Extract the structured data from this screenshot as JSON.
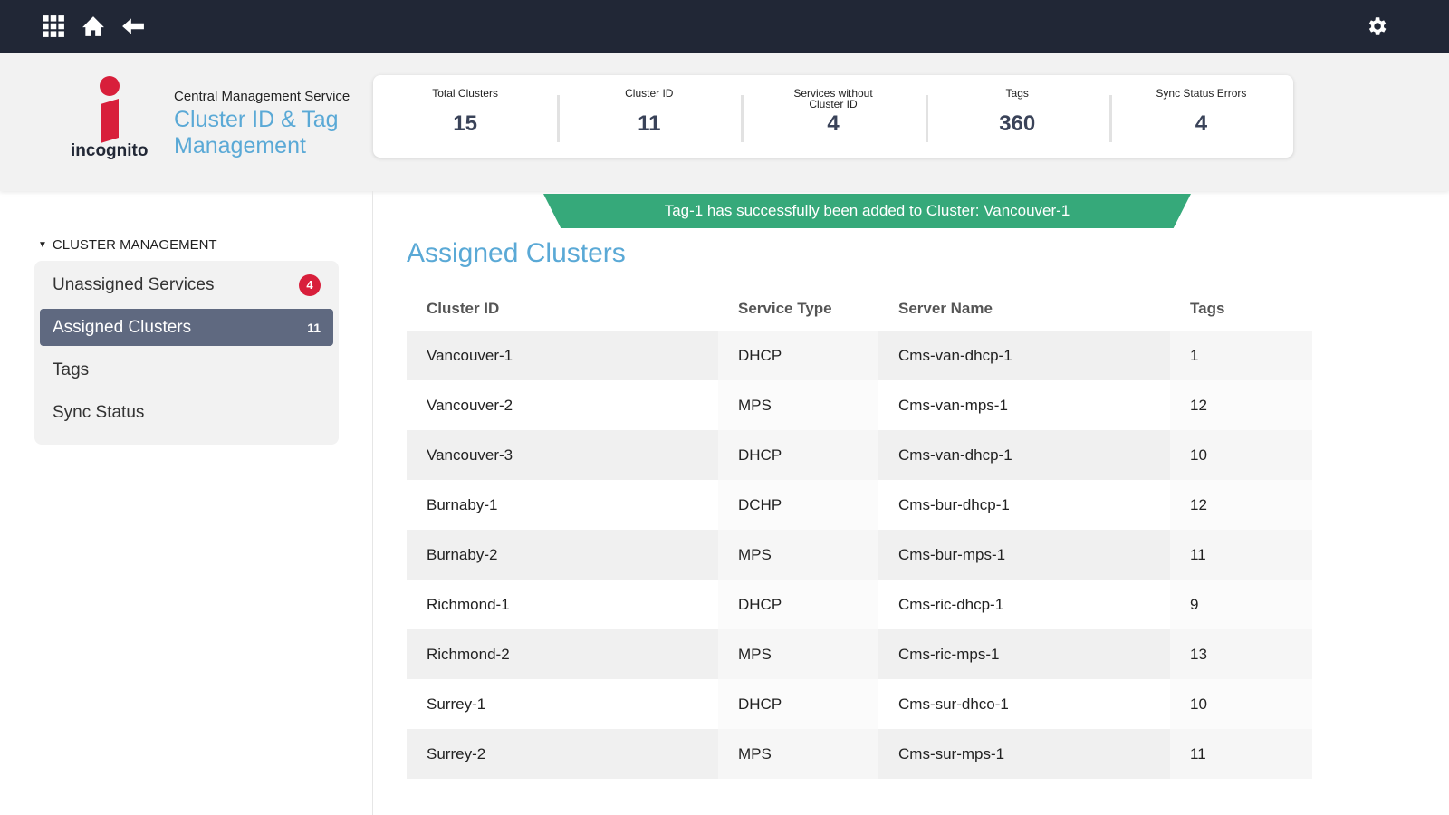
{
  "topbar": {
    "icons": [
      "apps-grid-icon",
      "home-icon",
      "back-arrow-icon",
      "gear-icon"
    ]
  },
  "header": {
    "logo_text": "incognito",
    "service": "Central Management Service",
    "title": "Cluster ID & Tag Management"
  },
  "stats": [
    {
      "label": "Total Clusters",
      "value": "15"
    },
    {
      "label": "Cluster ID",
      "value": "11"
    },
    {
      "label": "Services without Cluster ID",
      "value": "4"
    },
    {
      "label": "Tags",
      "value": "360"
    },
    {
      "label": "Sync Status Errors",
      "value": "4"
    }
  ],
  "sidebar": {
    "section": "CLUSTER MANAGEMENT",
    "items": [
      {
        "label": "Unassigned Services",
        "badge": "4"
      },
      {
        "label": "Assigned Clusters",
        "count": "11"
      },
      {
        "label": "Tags"
      },
      {
        "label": "Sync Status"
      }
    ]
  },
  "toast": "Tag-1 has successfully been added to Cluster: Vancouver-1",
  "main": {
    "title": "Assigned Clusters",
    "columns": [
      "Cluster ID",
      "Service Type",
      "Server Name",
      "Tags"
    ],
    "rows": [
      [
        "Vancouver-1",
        "DHCP",
        "Cms-van-dhcp-1",
        "1"
      ],
      [
        "Vancouver-2",
        "MPS",
        "Cms-van-mps-1",
        "12"
      ],
      [
        "Vancouver-3",
        "DHCP",
        "Cms-van-dhcp-1",
        "10"
      ],
      [
        "Burnaby-1",
        "DCHP",
        "Cms-bur-dhcp-1",
        "12"
      ],
      [
        "Burnaby-2",
        "MPS",
        "Cms-bur-mps-1",
        "11"
      ],
      [
        "Richmond-1",
        "DHCP",
        "Cms-ric-dhcp-1",
        "9"
      ],
      [
        "Richmond-2",
        "MPS",
        "Cms-ric-mps-1",
        "13"
      ],
      [
        "Surrey-1",
        "DHCP",
        "Cms-sur-dhco-1",
        "10"
      ],
      [
        "Surrey-2",
        "MPS",
        "Cms-sur-mps-1",
        "11"
      ]
    ]
  },
  "colors": {
    "topbar": "#212736",
    "accent": "#5aa9d6",
    "toast": "#36a97a",
    "badge": "#d81f3b",
    "active": "#5f6980"
  }
}
